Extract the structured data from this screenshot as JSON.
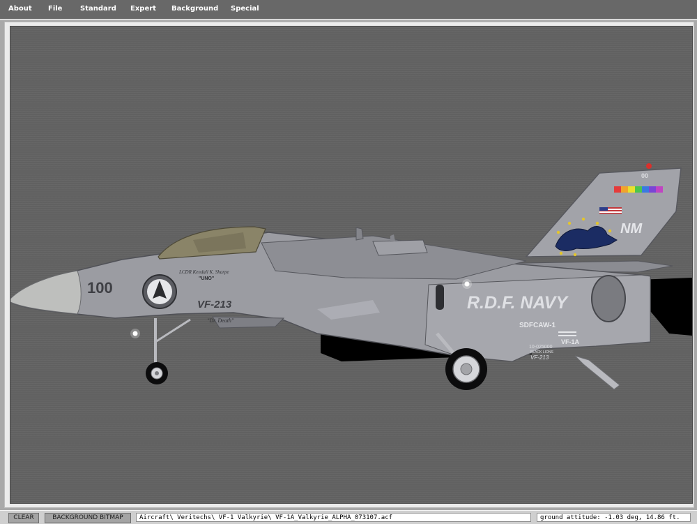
{
  "menu": {
    "items": [
      "About",
      "File",
      "Standard",
      "Expert",
      "Background",
      "Special"
    ]
  },
  "viewport": {
    "aircraft_markings": {
      "nose_number": "100",
      "squadron": "VF-213",
      "pilot_name": "LCDR Kendall K. Sharpe",
      "callsign": "\"UNO\"",
      "nickname": "\"Dr. Death\"",
      "service": "R.D.F. NAVY",
      "wing": "SDFCAW-1",
      "model": "VF-1A",
      "serial": "10-025000",
      "unit": "BLACK LIONS",
      "squadron_small": "VF-213",
      "tail_code": "NM",
      "tail_number": "00"
    },
    "colors": {
      "background": "#616161",
      "fuselage": "#9b9ca2",
      "canopy": "#8a8468",
      "shadow": "#000000"
    }
  },
  "statusbar": {
    "clear_label": "CLEAR",
    "background_bitmap_label": "BACKGROUND BITMAP",
    "path": "Aircraft\\ Veritechs\\ VF-1 Valkyrie\\ VF-1A_Valkyrie_ALPHA_073107.acf",
    "attitude": "ground attitude: -1.03 deg, 14.86 ft."
  }
}
